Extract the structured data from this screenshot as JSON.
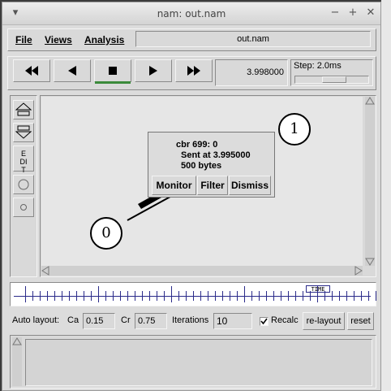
{
  "window": {
    "title": "nam: out.nam",
    "minimize": "▾",
    "min2": "−",
    "max": "+",
    "close": "✕"
  },
  "menu": {
    "file": "File",
    "views": "Views",
    "analysis": "Analysis"
  },
  "filename": "out.nam",
  "playback": {
    "rewind_icon": "fast-rewind",
    "back_icon": "play-backward",
    "stop_icon": "stop",
    "play_icon": "play-forward",
    "ff_icon": "fast-forward",
    "time": "3.998000",
    "step_label": "Step: 2.0ms"
  },
  "tools": {
    "edit_label": "EDIT"
  },
  "nodes": [
    {
      "label": "0"
    },
    {
      "label": "1"
    }
  ],
  "popup": {
    "line1": "cbr 699: 0",
    "line2": "Sent at 3.995000",
    "line3": "500 bytes",
    "monitor": "Monitor",
    "filter": "Filter",
    "dismiss": "Dismiss"
  },
  "timeline": {
    "marker": "TIME"
  },
  "layout": {
    "auto_layout": "Auto layout:",
    "ca_label": "Ca",
    "ca_value": "0.15",
    "cr_label": "Cr",
    "cr_value": "0.75",
    "iterations_label": "Iterations",
    "iterations_value": "10",
    "recalc_label": "Recalc",
    "recalc_checked": true,
    "relayout": "re-layout",
    "reset": "reset"
  },
  "colors": {
    "tick": "#2b2b8a",
    "stop_indicator": "#3a8a3a",
    "canvas": "#e6e6e6"
  }
}
